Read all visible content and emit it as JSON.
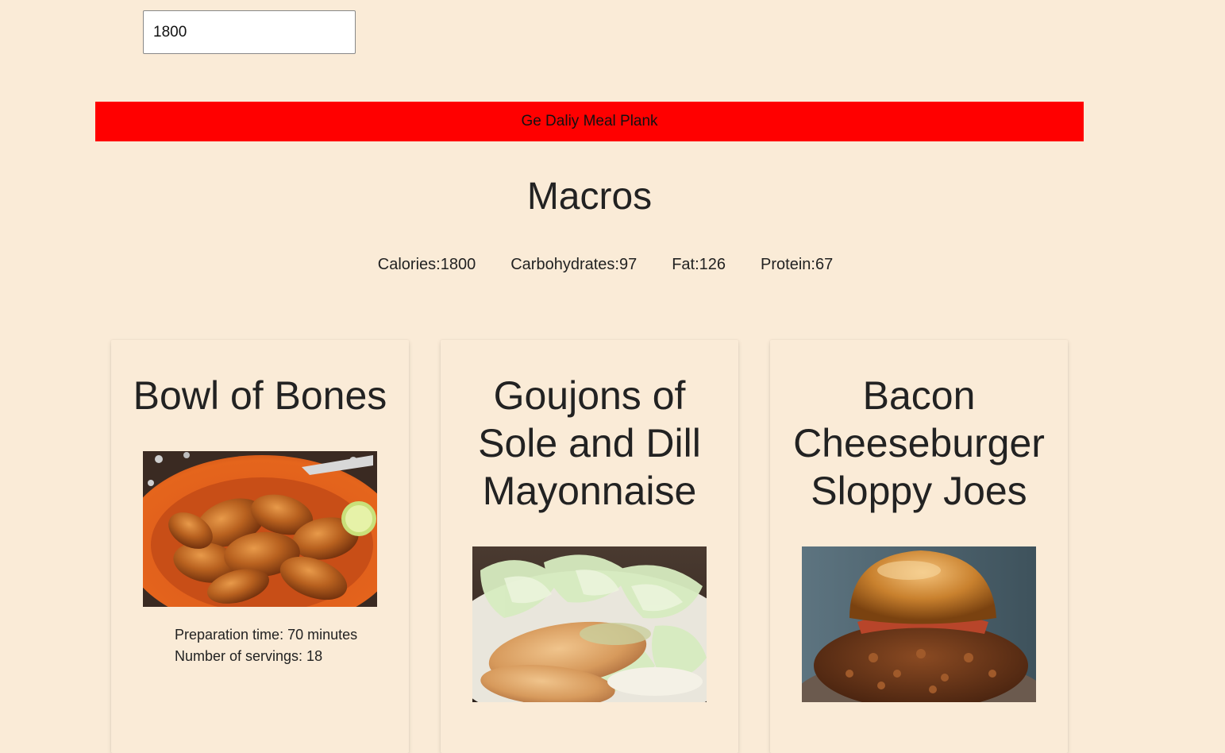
{
  "calorie_input": {
    "value": "1800"
  },
  "generate_button": {
    "label": "Ge Daliy Meal Plank"
  },
  "macros": {
    "title": "Macros",
    "calories_label": "Calories:1800",
    "carbohydrates_label": "Carbohydrates:97",
    "fat_label": "Fat:126",
    "protein_label": "Protein:67"
  },
  "meals": [
    {
      "title": "Bowl of Bones",
      "image": "chicken-wings-photo",
      "prep_time": "Preparation time: 70 minutes",
      "servings": "Number of servings: 18"
    },
    {
      "title": "Goujons of Sole and Dill Mayonnaise",
      "image": "fried-fish-salad-photo",
      "prep_time": "",
      "servings": ""
    },
    {
      "title": "Bacon Cheeseburger Sloppy Joes",
      "image": "sloppy-joe-burger-photo",
      "prep_time": "",
      "servings": ""
    }
  ],
  "colors": {
    "background": "#faebd7",
    "button": "#ff0000"
  }
}
